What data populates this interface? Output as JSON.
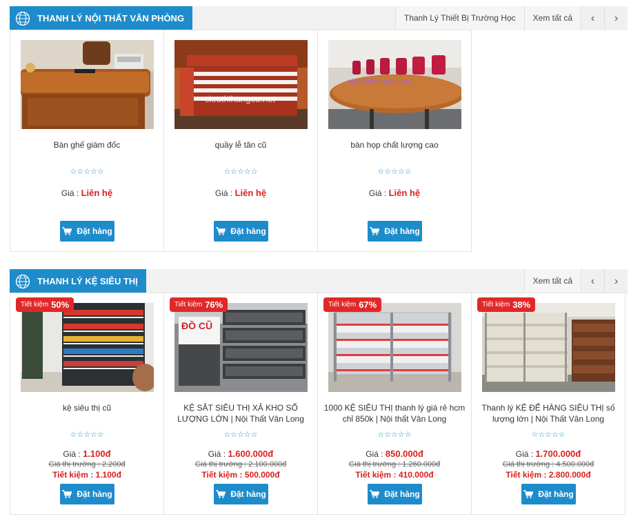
{
  "section1": {
    "title": "THANH LÝ NỘI THẤT VĂN PHÒNG",
    "links": [
      "Thanh Lý Thiết Bị Trường Học",
      "Xem tất cả"
    ],
    "products": [
      {
        "name": "Bàn ghế giám đốc",
        "stars": "☆☆☆☆☆",
        "price_label": "Giá : ",
        "price": "Liên hệ"
      },
      {
        "name": "quầy lễ tân cũ",
        "stars": "☆☆☆☆☆",
        "price_label": "Giá : ",
        "price": "Liên hệ",
        "watermark": "sieuthihangcu.net"
      },
      {
        "name": "bàn họp chất lượng cao",
        "stars": "☆☆☆☆☆",
        "price_label": "Giá : ",
        "price": "Liên hệ",
        "watermark": "sieuthihangcu.net"
      }
    ]
  },
  "section2": {
    "title": "THANH LÝ KỆ SIÊU THỊ",
    "links": [
      "Xem tất cả"
    ],
    "products": [
      {
        "badge_label": "Tiết kiệm",
        "badge_pct": "50%",
        "name": "kệ siêu thị cũ",
        "stars": "☆☆☆☆☆",
        "price_label": "Giá : ",
        "price": "1.100đ",
        "old_price": "Giá thị trường : 2.200đ",
        "save": "Tiết kiệm : 1.100đ"
      },
      {
        "badge_label": "Tiết kiệm",
        "badge_pct": "76%",
        "name": "KỆ SẮT SIÊU THỊ XẢ KHO SỐ LƯỢNG LỚN | Nội Thất Vân Long",
        "stars": "☆☆☆☆☆",
        "price_label": "Giá : ",
        "price": "1.600.000đ",
        "old_price": "Giá thị trường : 2.100.000đ",
        "save": "Tiết kiệm : 500.000đ",
        "sign": "ĐỒ CŨ"
      },
      {
        "badge_label": "Tiết kiệm",
        "badge_pct": "67%",
        "name": "1000 KỆ SIÊU THỊ thanh lý giá rẻ hcm chỉ 850k | Nội thất Vân Long",
        "stars": "☆☆☆☆☆",
        "price_label": "Giá : ",
        "price": "850.000đ",
        "old_price": "Giá thị trường : 1.260.000đ",
        "save": "Tiết kiệm : 410.000đ"
      },
      {
        "badge_label": "Tiết kiệm",
        "badge_pct": "38%",
        "name": "Thanh lý KỆ ĐỂ HÀNG SIÊU THỊ số lượng lớn | Nội Thất Vân Long",
        "stars": "☆☆☆☆☆",
        "price_label": "Giá : ",
        "price": "1.700.000đ",
        "old_price": "Giá thị trường : 4.500.000đ",
        "save": "Tiết kiệm : 2.800.000đ"
      }
    ]
  },
  "order_label": "Đặt hàng",
  "colors": {
    "brand": "#1e8ccb",
    "price": "#d8201f",
    "badge": "#e12828"
  },
  "icons": {
    "globe": "globe-icon",
    "cart": "cart-icon",
    "prev": "chevron-left-icon",
    "next": "chevron-right-icon",
    "star": "star-outline-icon"
  }
}
